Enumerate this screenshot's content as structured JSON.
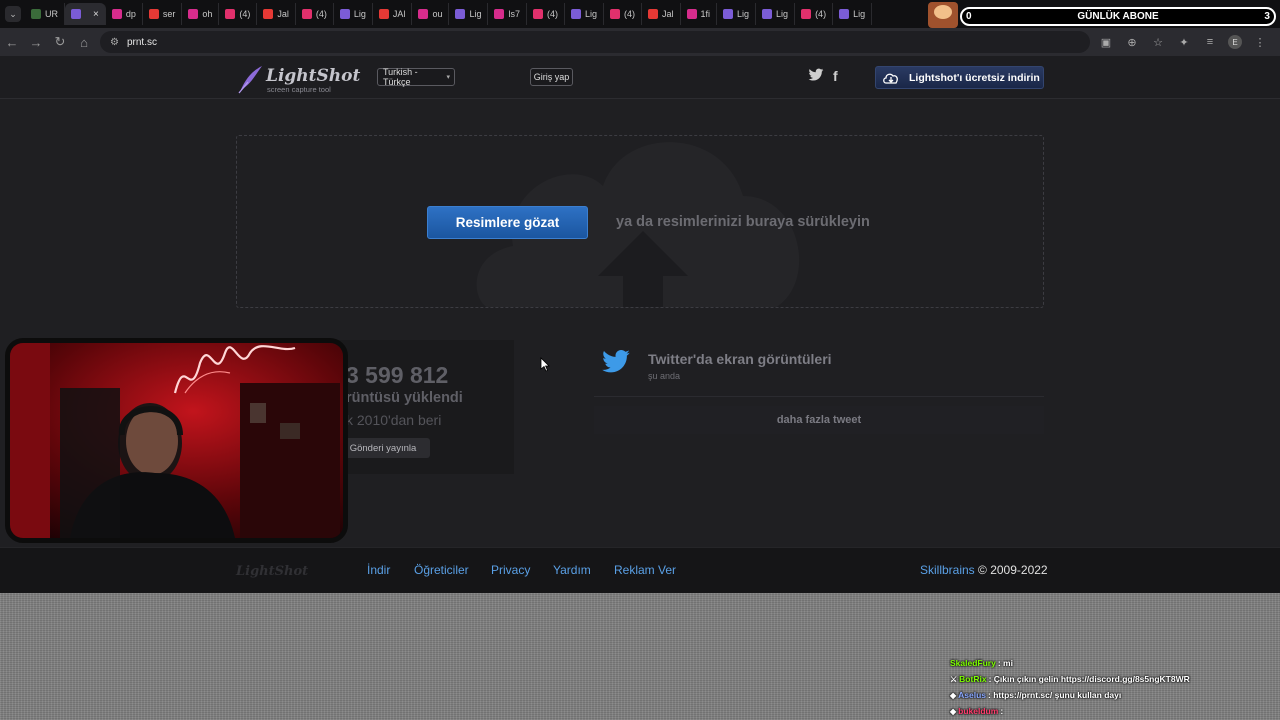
{
  "browser": {
    "tabs": [
      {
        "label": "UR",
        "color": "#3a6b3a"
      },
      {
        "label": "",
        "color": "#7b5cd6",
        "active": true,
        "close": "×"
      },
      {
        "label": "dp",
        "color": "#d62c8c"
      },
      {
        "label": "ser",
        "color": "#e53935"
      },
      {
        "label": "oh",
        "color": "#d62c8c"
      },
      {
        "label": "(4)",
        "color": "#e1306c"
      },
      {
        "label": "Jal",
        "color": "#e53935"
      },
      {
        "label": "(4)",
        "color": "#e1306c"
      },
      {
        "label": "Lig",
        "color": "#7b5cd6"
      },
      {
        "label": "JAl",
        "color": "#e53935"
      },
      {
        "label": "ou",
        "color": "#d62c8c"
      },
      {
        "label": "Lig",
        "color": "#7b5cd6"
      },
      {
        "label": "ls7",
        "color": "#d62c8c"
      },
      {
        "label": "(4)",
        "color": "#e1306c"
      },
      {
        "label": "Lig",
        "color": "#7b5cd6"
      },
      {
        "label": "(4)",
        "color": "#e1306c"
      },
      {
        "label": "Jal",
        "color": "#e53935"
      },
      {
        "label": "1fi",
        "color": "#d62c8c"
      },
      {
        "label": "Lig",
        "color": "#7b5cd6"
      },
      {
        "label": "Lig",
        "color": "#7b5cd6"
      },
      {
        "label": "(4)",
        "color": "#e1306c"
      },
      {
        "label": "Lig",
        "color": "#7b5cd6"
      }
    ],
    "url": "prnt.sc"
  },
  "overlay": {
    "left_count": "0",
    "label": "GÜNLÜK ABONE",
    "right_count": "3"
  },
  "header": {
    "logo_title": "LightShot",
    "logo_subtitle": "screen capture tool",
    "language": "Turkish - Türkçe",
    "login": "Giriş yap",
    "download": "Lightshot'ı ücretsiz indirin"
  },
  "upload": {
    "browse_button": "Resimlere gözat",
    "drag_text": "ya da resimlerinizi buraya sürükleyin"
  },
  "counter": {
    "number": "3 599 812",
    "line1": "rüntüsü yüklendi",
    "line2": "k 2010'dan beri",
    "publish": "Gönderi yayınla"
  },
  "twitter": {
    "title": "Twitter'da ekran görüntüleri",
    "subtitle": "şu anda",
    "more": "daha fazla tweet"
  },
  "footer": {
    "logo": "LightShot",
    "links": [
      "İndir",
      "Öğreticiler",
      "Privacy",
      "Yardım",
      "Reklam Ver"
    ],
    "copyright_brand": "Skillbrains",
    "copyright_text": " © 2009-2022"
  },
  "chat": [
    {
      "user": "SkaledFury",
      "user_color": "#7cfc00",
      "msg": ": mi",
      "icon": ""
    },
    {
      "user": "BotRix",
      "user_color": "#7cfc00",
      "msg": ": Çıkın çıkın gelin https://discord.gg/8s5ngKT8WR",
      "icon": "⚔"
    },
    {
      "user": "Aselus",
      "user_color": "#8aa8ff",
      "msg": ": https://prnt.sc/ şunu kullan dayı",
      "icon": "◆"
    },
    {
      "user": "bukeldum",
      "user_color": "#ff3b6b",
      "msg": ":",
      "icon": "◆"
    }
  ],
  "colors": {
    "accent_blue": "#1b56a0",
    "link_blue": "#5aa0e6",
    "page_bg": "#1f1f22"
  }
}
